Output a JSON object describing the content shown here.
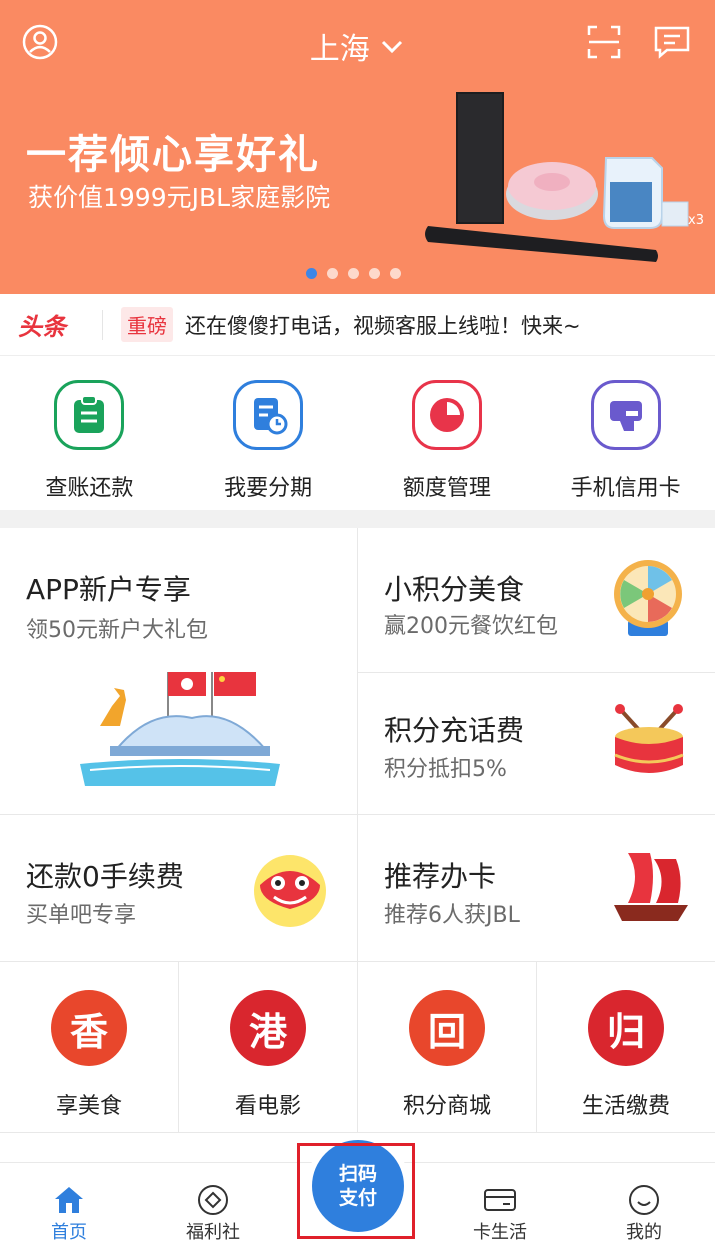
{
  "topbar": {
    "city": "上海",
    "icons": [
      "user-icon",
      "chevron-down-icon",
      "scan-icon",
      "message-icon"
    ]
  },
  "banner": {
    "title": "一荐倾心享好礼",
    "subtitle": "获价值1999元JBL家庭影院",
    "slide_count": 5,
    "active_slide": 1,
    "product_badge": "x3",
    "color": "#fa8a62"
  },
  "ticker": {
    "logo": "头条",
    "tag": "重磅",
    "text": "还在傻傻打电话，视频客服上线啦！快来~"
  },
  "quick_actions": [
    {
      "label": "查账还款",
      "color": "#1aa35b"
    },
    {
      "label": "我要分期",
      "color": "#2f7fdd"
    },
    {
      "label": "额度管理",
      "color": "#e8344a"
    },
    {
      "label": "手机信用卡",
      "color": "#6a5acd"
    }
  ],
  "promos": {
    "app_new": {
      "title": "APP新户专享",
      "sub": "领50元新户大礼包"
    },
    "points_food": {
      "title": "小积分美食",
      "sub": "赢200元餐饮红包"
    },
    "points_phone": {
      "title": "积分充话费",
      "sub": "积分抵扣5%"
    },
    "repay_fee": {
      "title": "还款0手续费",
      "sub": "买单吧专享"
    },
    "recommend": {
      "title": "推荐办卡",
      "sub": "推荐6人获JBL"
    }
  },
  "services": [
    {
      "label": "享美食",
      "glyph": "香",
      "color": "#e8472c"
    },
    {
      "label": "看电影",
      "glyph": "港",
      "color": "#d9262e"
    },
    {
      "label": "积分商城",
      "glyph": "回",
      "color": "#e8472c"
    },
    {
      "label": "生活缴费",
      "glyph": "归",
      "color": "#d9262e"
    }
  ],
  "bottom_nav": {
    "home": "首页",
    "welfare": "福利社",
    "scan_line1": "扫码",
    "scan_line2": "支付",
    "card_life": "卡生活",
    "mine": "我的",
    "active_color": "#2f7fdd"
  }
}
